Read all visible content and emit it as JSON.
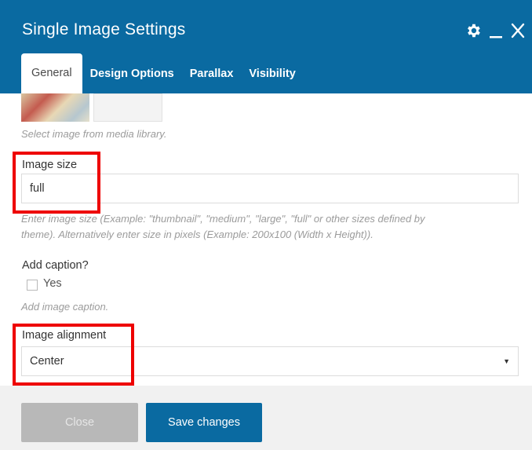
{
  "dialog": {
    "title": "Single Image Settings"
  },
  "tabs": [
    {
      "label": "General",
      "active": true
    },
    {
      "label": "Design Options",
      "active": false
    },
    {
      "label": "Parallax",
      "active": false
    },
    {
      "label": "Visibility",
      "active": false
    }
  ],
  "image_picker": {
    "help": "Select image from media library."
  },
  "image_size": {
    "label": "Image size",
    "value": "full",
    "help_line1": "Enter image size (Example: \"thumbnail\", \"medium\", \"large\", \"full\" or other sizes defined by",
    "help_line2": "theme). Alternatively enter size in pixels (Example: 200x100 (Width x Height))."
  },
  "caption": {
    "label": "Add caption?",
    "checkbox_label": "Yes",
    "checked": false,
    "help": "Add image caption."
  },
  "alignment": {
    "label": "Image alignment",
    "selected": "Center"
  },
  "footer": {
    "close_label": "Close",
    "save_label": "Save changes"
  },
  "icons": {
    "header": [
      "gear-icon",
      "minimize-icon",
      "close-icon"
    ],
    "select": "caret-down-icon"
  },
  "colors": {
    "header_bg": "#0a6aa1",
    "highlight": "#ee0000",
    "close_btn": "#b8b8b8",
    "save_btn": "#0a6aa1"
  }
}
